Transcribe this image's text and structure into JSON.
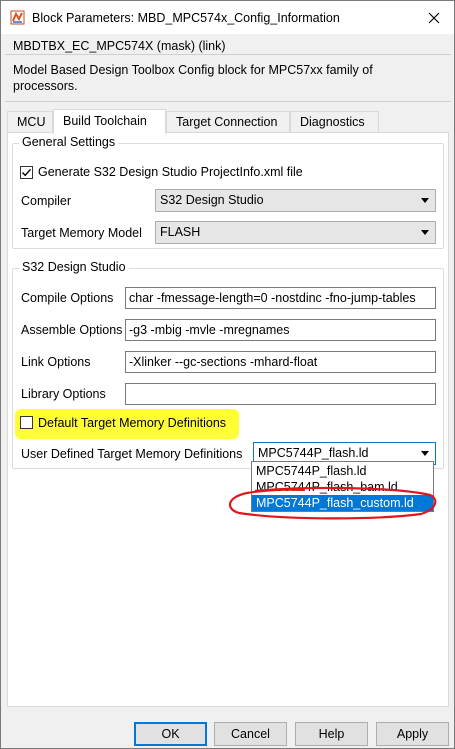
{
  "window": {
    "title": "Block Parameters: MBD_MPC574x_Config_Information",
    "close_icon": "close-icon",
    "app_icon": "simulink-block-icon"
  },
  "mask": {
    "header": "MBDTBX_EC_MPC574X (mask) (link)",
    "description_line1": "Model Based Design Toolbox Config block for MPC57xx family of",
    "description_line2": "processors."
  },
  "tabs": [
    {
      "label": "MCU",
      "active": false
    },
    {
      "label": "Build Toolchain",
      "active": true
    },
    {
      "label": "Target Connection",
      "active": false
    },
    {
      "label": "Diagnostics",
      "active": false
    }
  ],
  "general_settings": {
    "label": "General Settings",
    "generate_projectinfo": {
      "label": "Generate S32 Design Studio ProjectInfo.xml file",
      "checked": true
    },
    "compiler": {
      "label": "Compiler",
      "value": "S32 Design Studio"
    },
    "target_memory_model": {
      "label": "Target Memory Model",
      "value": "FLASH"
    }
  },
  "s32ds": {
    "label": "S32 Design Studio",
    "compile_options": {
      "label": "Compile Options",
      "value": "char -fmessage-length=0 -nostdinc -fno-jump-tables"
    },
    "assemble_options": {
      "label": "Assemble Options",
      "value": "-g3 -mbig -mvle -mregnames"
    },
    "link_options": {
      "label": "Link Options",
      "value": "-Xlinker --gc-sections -mhard-float"
    },
    "library_options": {
      "label": "Library Options",
      "value": ""
    },
    "default_memory_defs": {
      "label": "Default Target Memory Definitions",
      "checked": false
    },
    "user_memory_defs": {
      "label": "User Defined Target Memory Definitions",
      "value": "MPC5744P_flash.ld",
      "options": [
        "MPC5744P_flash.ld",
        "MPC5744P_flash_bam.ld",
        "MPC5744P_flash_custom.ld"
      ],
      "highlighted_option": "MPC5744P_flash_custom.ld"
    }
  },
  "annotations": {
    "highlight_color": "#ffff33",
    "circle_color": "#e0161e"
  },
  "footer": {
    "ok": "OK",
    "cancel": "Cancel",
    "help": "Help",
    "apply": "Apply"
  }
}
